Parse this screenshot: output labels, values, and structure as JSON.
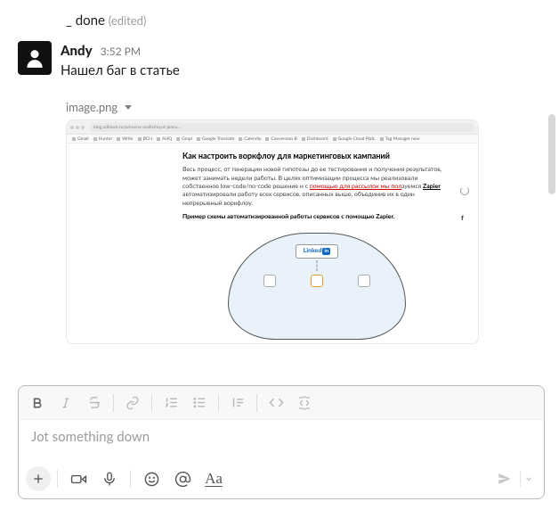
{
  "prior_message": {
    "text": "_ done",
    "edited_label": "(edited)"
  },
  "message": {
    "sender": "Andy",
    "timestamp": "3:52 PM",
    "text": "Нашел баг в статье"
  },
  "attachment": {
    "filename": "image.png",
    "url_fragment": "blog.adblock.ru/primena-analiziruyut-plana…",
    "article_title": "Как настроить воркфлоу для маркетинговых кампаний",
    "article_p1_a": "Весь процесс, от генерации новой гипотезы до ее тестирования и получения результатов, может занимать недели работы. В целях оптимизации процесса мы реализовали собственное low-code/no-code решение и с ",
    "article_p1_red": "помощью для рассылок мы пол",
    "article_p1_b": "зуемся ",
    "article_p1_link": "Zapier",
    "article_p1_c": " автоматизировали работу всех сервисов, описанных выше, объединив их в один непрерывный воркфлоу.",
    "article_p2": "Пример схемы автоматизированной работы сервисов с помощью Zapier.",
    "linkedin_label": "Linked",
    "linkedin_in": "in"
  },
  "composer": {
    "placeholder": "Jot something down"
  },
  "icons": {
    "bold": "bold-icon",
    "italic": "italic-icon",
    "strike": "strikethrough-icon",
    "link": "link-icon",
    "ol": "ordered-list-icon",
    "ul": "bullet-list-icon",
    "quote": "blockquote-icon",
    "code": "code-icon",
    "codeblock": "code-block-icon",
    "plus": "plus-icon",
    "video": "video-icon",
    "mic": "microphone-icon",
    "emoji": "emoji-icon",
    "mention": "mention-icon",
    "format": "format-icon",
    "send": "send-icon",
    "caret": "chevron-down-icon"
  }
}
